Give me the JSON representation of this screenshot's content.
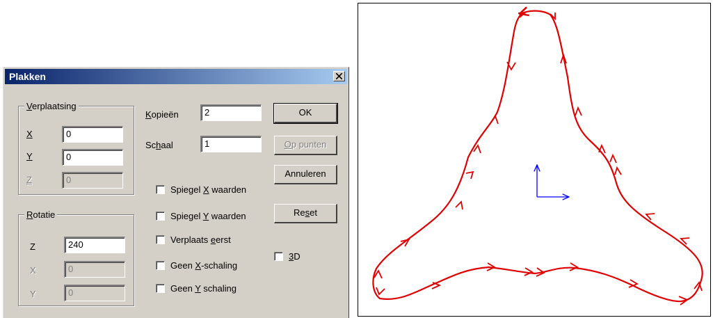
{
  "dialog": {
    "title": "Plakken",
    "close_glyph": "×",
    "verplaatsing": {
      "legend_u": "V",
      "legend_rest": "erplaatsing",
      "x_label": "X",
      "x_value": "0",
      "y_label": "Y",
      "y_value": "0",
      "z_label": "Z",
      "z_value": "0"
    },
    "rotatie": {
      "legend_u": "R",
      "legend_rest": "otatie",
      "z_label": "Z",
      "z_value": "240",
      "x_label": "X",
      "x_value": "0",
      "y_label": "Y",
      "y_value": "0"
    },
    "kopieen": {
      "label_u": "K",
      "label_rest": "opieën",
      "value": "2"
    },
    "schaal": {
      "label_pre": "Sc",
      "label_u": "h",
      "label_rest": "aal",
      "value": "1"
    },
    "buttons": {
      "ok": "OK",
      "op_punten_u": "O",
      "op_punten_rest": "p punten",
      "annuleren": "Annuleren",
      "reset_pre": "Re",
      "reset_u": "s",
      "reset_rest": "et"
    },
    "checks": {
      "spiegel_x": {
        "pre": "Spiegel ",
        "u": "X",
        "post": " waarden",
        "checked": false
      },
      "spiegel_y": {
        "pre": "Spiegel ",
        "u": "Y",
        "post": " waarden",
        "checked": false
      },
      "verplaats_eerst": {
        "pre": "Verplaats ",
        "u": "e",
        "post": "erst",
        "checked": false
      },
      "geen_x": {
        "pre": "Geen ",
        "u": "X",
        "post": "-schaling",
        "checked": false
      },
      "geen_y": {
        "pre": "Geen ",
        "u": "Y",
        "post": " schaling",
        "checked": false
      },
      "three_d": {
        "pre": "",
        "u": "3",
        "post": "D",
        "checked": false
      }
    }
  },
  "canvas": {
    "path_color": "#e00000",
    "axis_color": "#0000ff"
  }
}
